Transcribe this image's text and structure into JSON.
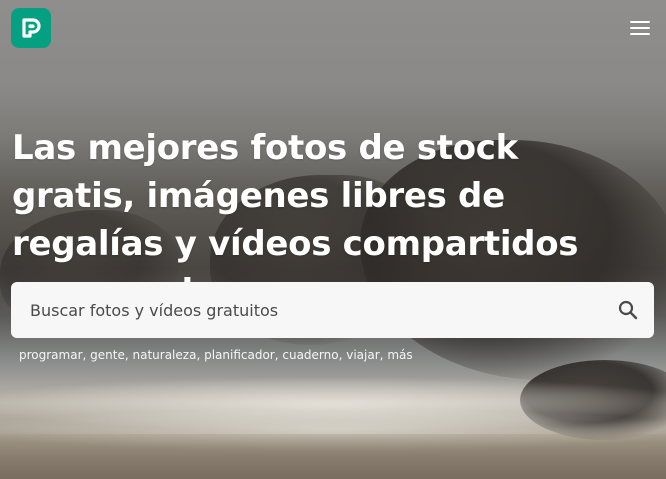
{
  "header": {
    "logo_icon": "pexels-logo-icon",
    "brand_color": "#05a081",
    "menu_icon": "hamburger-menu-icon"
  },
  "hero": {
    "headline": "Las mejores fotos de stock gratis, imágenes libres de regalías y vídeos compartidos por creadores."
  },
  "search": {
    "placeholder": "Buscar fotos y vídeos gratuitos",
    "value": "",
    "icon": "search-icon"
  },
  "suggestions": {
    "items": [
      {
        "label": "programar"
      },
      {
        "label": "gente"
      },
      {
        "label": "naturaleza"
      },
      {
        "label": "planificador"
      },
      {
        "label": "cuaderno"
      },
      {
        "label": "viajar"
      },
      {
        "label": "más"
      }
    ],
    "separator": ", "
  }
}
